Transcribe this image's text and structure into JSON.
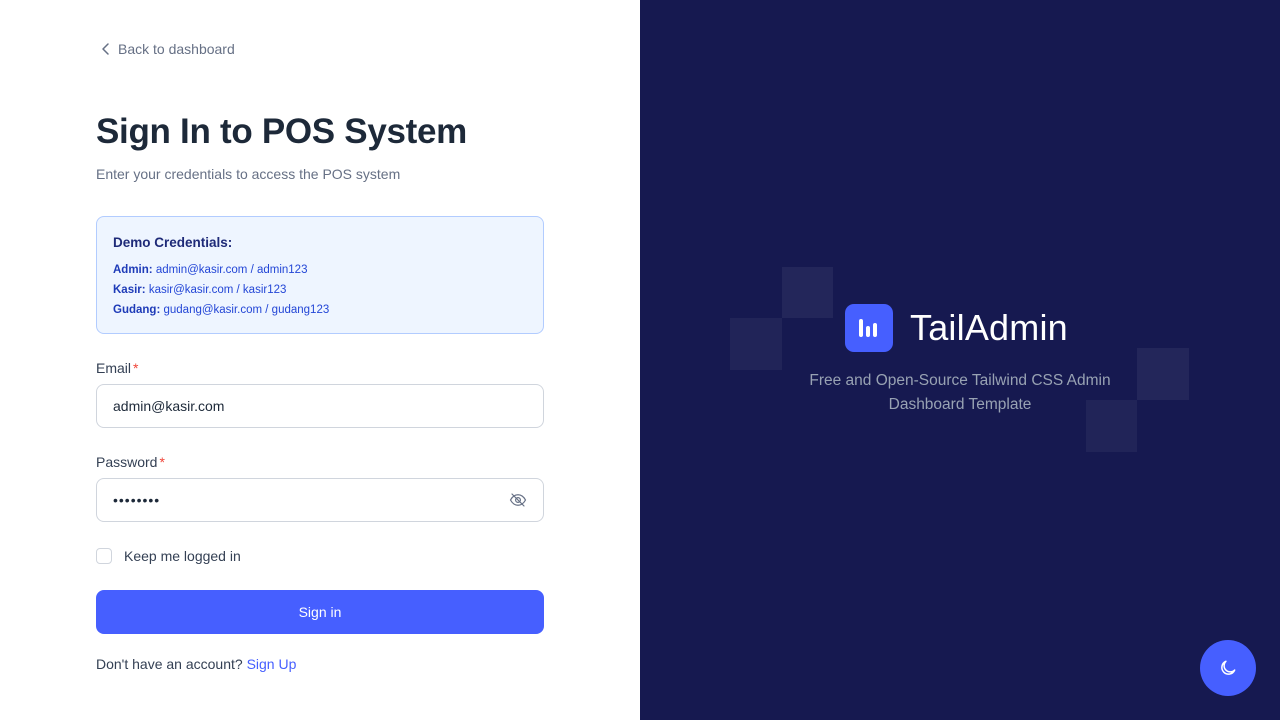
{
  "nav": {
    "back_label": "Back to dashboard"
  },
  "form": {
    "title": "Sign In to POS System",
    "subtitle": "Enter your credentials to access the POS system",
    "demo": {
      "title": "Demo Credentials:",
      "lines": [
        {
          "role": "Admin:",
          "value": "admin@kasir.com / admin123"
        },
        {
          "role": "Kasir:",
          "value": "kasir@kasir.com / kasir123"
        },
        {
          "role": "Gudang:",
          "value": "gudang@kasir.com / gudang123"
        }
      ]
    },
    "email": {
      "label": "Email",
      "required_mark": "*",
      "value": "admin@kasir.com"
    },
    "password": {
      "label": "Password",
      "required_mark": "*",
      "value": "••••••••"
    },
    "remember_label": "Keep me logged in",
    "remember_checked": false,
    "submit_label": "Sign in",
    "signup_prompt": "Don't have an account?",
    "signup_link": "Sign Up"
  },
  "brand": {
    "name": "TailAdmin",
    "tagline": "Free and Open-Source Tailwind CSS Admin Dashboard Template"
  },
  "colors": {
    "accent": "#465fff",
    "panel_bg": "#161950",
    "demo_bg": "#eef5ff",
    "demo_border": "#b2ccff",
    "required": "#f04438"
  },
  "icons": {
    "back": "chevron-left-icon",
    "password_toggle": "eye-off-icon",
    "logo": "bar-chart-icon",
    "theme": "moon-icon"
  }
}
